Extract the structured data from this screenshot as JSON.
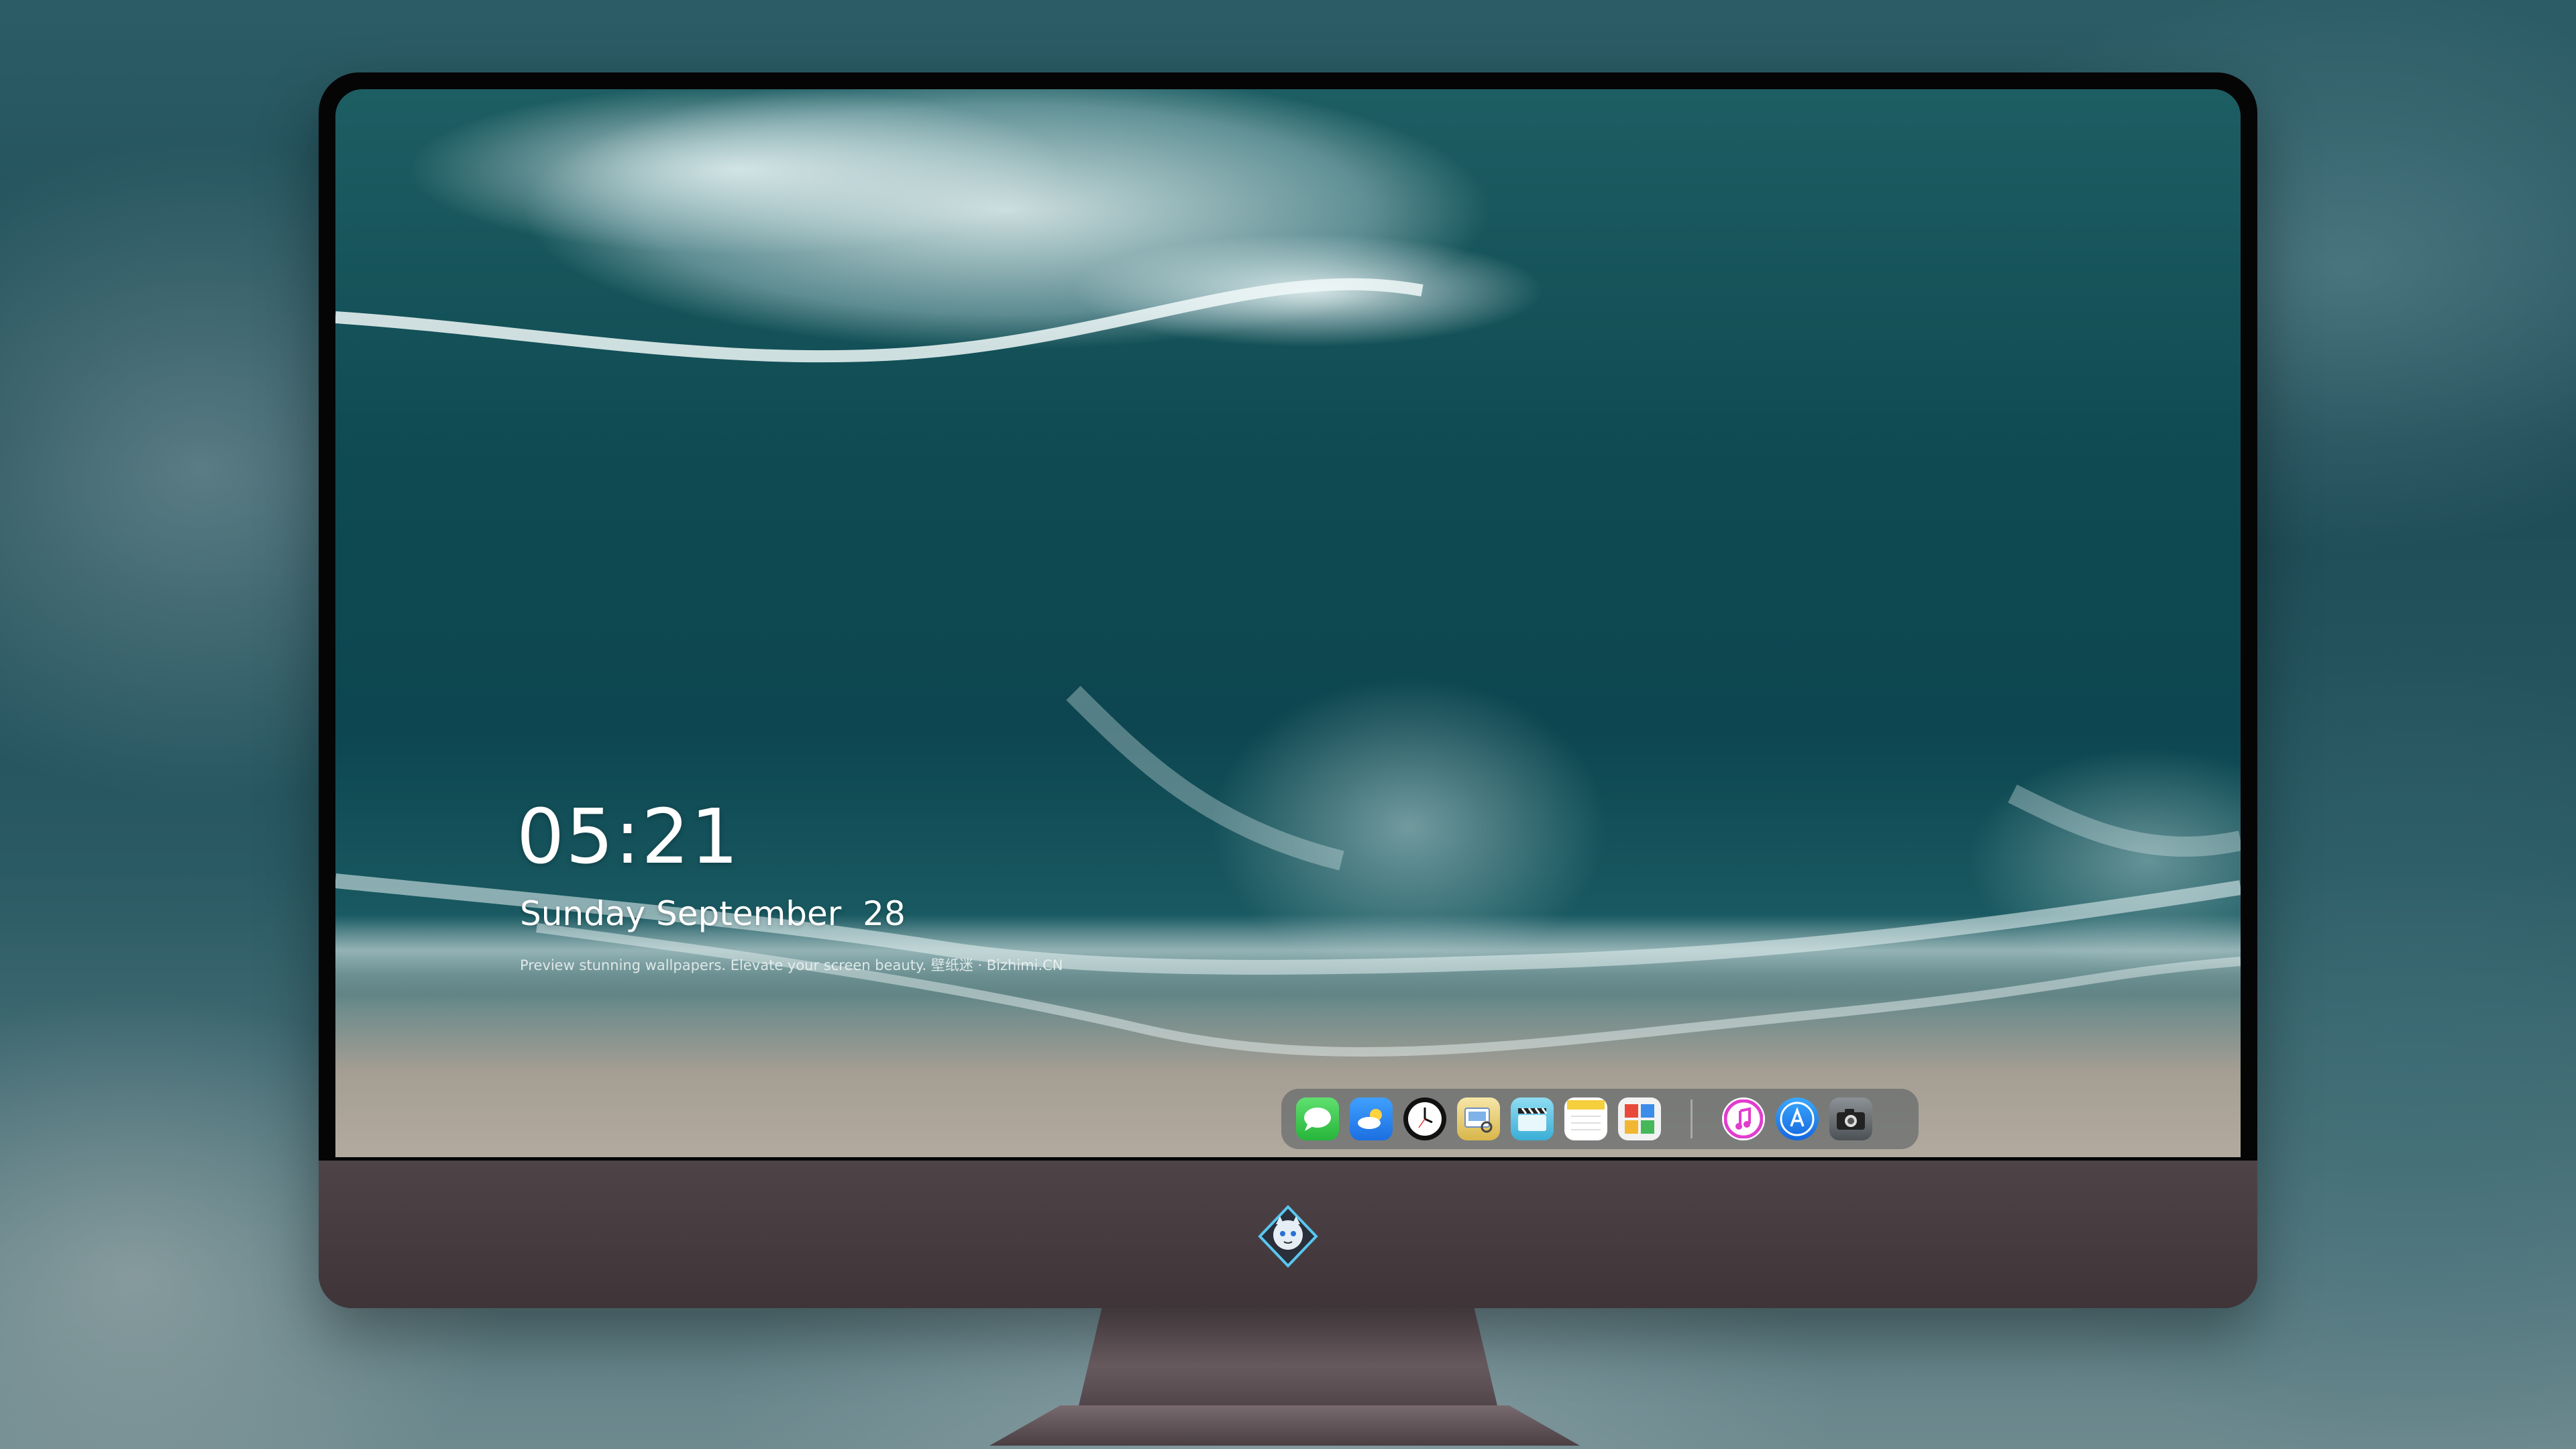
{
  "lockscreen": {
    "time": "05:21",
    "date": "Sunday September  28",
    "tagline": "Preview stunning wallpapers. Elevate your screen beauty. 壁纸迷 · Bizhimi.CN"
  },
  "dock": {
    "apps": [
      {
        "name": "Messages",
        "icon": "messages-icon",
        "color": "#34c759"
      },
      {
        "name": "Weather",
        "icon": "weather-icon",
        "color": "#2e8cf0"
      },
      {
        "name": "Clock",
        "icon": "clock-icon",
        "color": "#111111"
      },
      {
        "name": "Preview",
        "icon": "preview-icon",
        "color": "#e9c85a"
      },
      {
        "name": "Clips",
        "icon": "clapperboard-icon",
        "color": "#5bc6e8"
      },
      {
        "name": "Notes",
        "icon": "notes-icon",
        "color": "#f7d64c"
      },
      {
        "name": "Photo Booth",
        "icon": "photo-booth-icon",
        "color": "#d84a3c"
      },
      {
        "name": "iTunes",
        "icon": "music-icon",
        "color": "#e23ccf"
      },
      {
        "name": "App Store",
        "icon": "app-store-icon",
        "color": "#1e88f0"
      },
      {
        "name": "Camera",
        "icon": "camera-icon",
        "color": "#5a5f63"
      }
    ]
  },
  "brand": {
    "logo": "mascot-logo"
  }
}
